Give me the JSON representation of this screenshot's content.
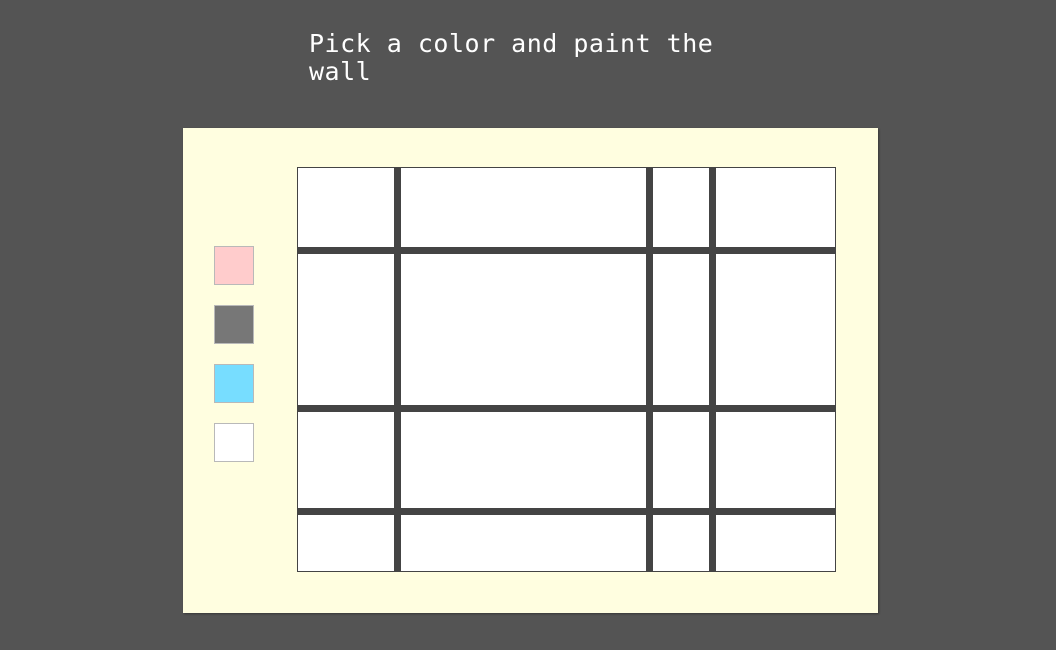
{
  "instruction": "Pick a color and paint the wall",
  "colors": {
    "background": "#545454",
    "board": "#fffee0",
    "wall_lines": "#444444",
    "cell_default": "#ffffff"
  },
  "palette": [
    {
      "name": "pink",
      "color": "#ffcccc"
    },
    {
      "name": "gray",
      "color": "#777777"
    },
    {
      "name": "light-blue",
      "color": "#77ddff"
    },
    {
      "name": "white",
      "color": "#ffffff"
    }
  ],
  "wall": {
    "rows": 4,
    "columns": 4,
    "cell_color": "#ffffff"
  }
}
